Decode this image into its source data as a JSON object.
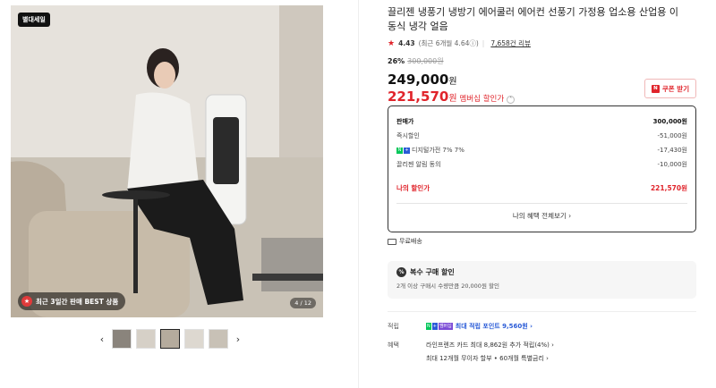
{
  "gallery": {
    "badge_top": "별대세일",
    "bottom_pill": "최근 3일간 판매 BEST 상품",
    "counter": "4 / 12",
    "prev": "‹",
    "next": "›",
    "thumbnails": [
      "thumb-1",
      "thumb-2",
      "thumb-3",
      "thumb-4",
      "thumb-5"
    ]
  },
  "product": {
    "title": "끌리젠 냉풍기 냉방기 에어쿨러 에어컨 선풍기 가정용 업소용 산업용 이동식 냉각 얼음",
    "rating": "4.43",
    "rating_sub": "(최근 6개월 4.64ⓘ)",
    "reviews": "7,658건 리뷰",
    "discount_pct": "26%",
    "original_price": "300,000원",
    "price": "249,000",
    "price_unit": "원",
    "member_price": "221,570",
    "member_unit": "원",
    "member_label": "멤버십 할인가",
    "coupon_button": "쿠폰 받기",
    "coupon_icon": "N"
  },
  "price_box": {
    "rows": [
      {
        "label": "판매가",
        "value": "300,000원"
      },
      {
        "label": "즉시할인",
        "value": "-51,000원"
      },
      {
        "label": "디지털가전 7% 7%",
        "value": "-17,430원"
      },
      {
        "label": "끌리젠 알림 동의",
        "value": "-10,000원"
      }
    ],
    "final_label": "나의 할인가",
    "final_value": "221,570원",
    "more": "나의 혜택 전체보기 ›"
  },
  "shipping": "무료배송",
  "multi_buy": {
    "title": "복수 구매 할인",
    "desc": "2개 이상 구매시 수량만큼 20,000원 할인",
    "icon": "%"
  },
  "benefits": {
    "point_label": "적립",
    "point_text": "최대 적립 포인트 9,560원 ›",
    "benefit_label": "혜택",
    "benefit_line1": "라인프렌즈 카드 최대 8,862원 추가 적립(4%) ›",
    "benefit_line2": "최대 12개월 무이자 할부 • 60개월 특별금리 ›"
  },
  "colors": {
    "accent_red": "#e0242b",
    "link_blue": "#2a5bd7",
    "naver_green": "#03c75a"
  }
}
